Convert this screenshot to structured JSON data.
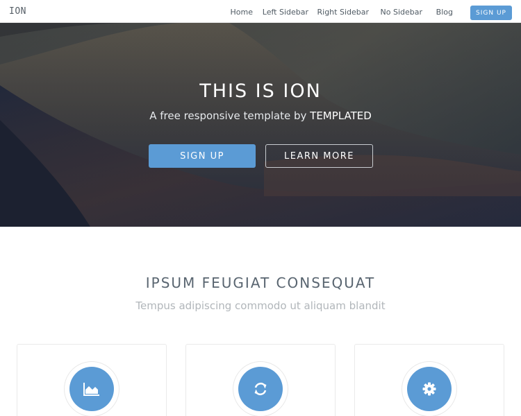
{
  "header": {
    "logo": "ION",
    "nav": [
      "Home",
      "Left Sidebar",
      "Right Sidebar",
      "No Sidebar",
      "Blog"
    ],
    "signup_label": "SIGN UP"
  },
  "hero": {
    "title": "THIS IS ION",
    "subtitle_prefix": "A free responsive template by ",
    "subtitle_brand": "TEMPLATED",
    "primary_button": "SIGN UP",
    "secondary_button": "LEARN MORE"
  },
  "features": {
    "title": "IPSUM FEUGIAT CONSEQUAT",
    "subtitle": "Tempus adipiscing commodo ut aliquam blandit",
    "cards": [
      {
        "icon": "area-chart-icon"
      },
      {
        "icon": "refresh-icon"
      },
      {
        "icon": "gear-icon"
      }
    ]
  },
  "colors": {
    "accent": "#5b9bd5",
    "heading": "#596570",
    "muted": "#b1b6ba"
  }
}
